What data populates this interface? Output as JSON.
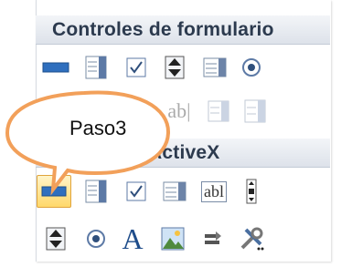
{
  "sections": {
    "form_controls": {
      "title": "Controles de formulario"
    },
    "activex": {
      "title": "Controles ActiveX"
    }
  },
  "callout": {
    "text": "Paso3",
    "border_color": "#f2a05a",
    "fill_color": "#ffffff"
  },
  "colors": {
    "accent_blue": "#2f6fbe",
    "header_text": "#2c3a4e",
    "selected_fill": "#ffd86a"
  },
  "form_controls_row1": [
    {
      "icon": "button-icon"
    },
    {
      "icon": "combo-box-icon"
    },
    {
      "icon": "checkbox-icon"
    },
    {
      "icon": "spin-button-icon"
    },
    {
      "icon": "list-box-icon"
    },
    {
      "icon": "option-button-icon"
    }
  ],
  "form_controls_row2": [
    {
      "icon": "group-box-icon"
    },
    {
      "icon": "label-icon",
      "text": "ab|"
    },
    {
      "icon": "combo-list-edit-icon"
    },
    {
      "icon": "combo-drop-edit-icon"
    }
  ],
  "activex_row1": [
    {
      "icon": "command-button-icon",
      "selected": true
    },
    {
      "icon": "combo-box-icon"
    },
    {
      "icon": "checkbox-icon"
    },
    {
      "icon": "list-box-icon"
    },
    {
      "icon": "text-box-icon",
      "text": "abl"
    },
    {
      "icon": "scroll-bar-icon"
    }
  ],
  "activex_row2": [
    {
      "icon": "spin-button-icon"
    },
    {
      "icon": "option-button-icon"
    },
    {
      "icon": "label-icon",
      "text": "A"
    },
    {
      "icon": "image-icon"
    },
    {
      "icon": "toggle-button-icon"
    },
    {
      "icon": "more-controls-icon"
    }
  ]
}
